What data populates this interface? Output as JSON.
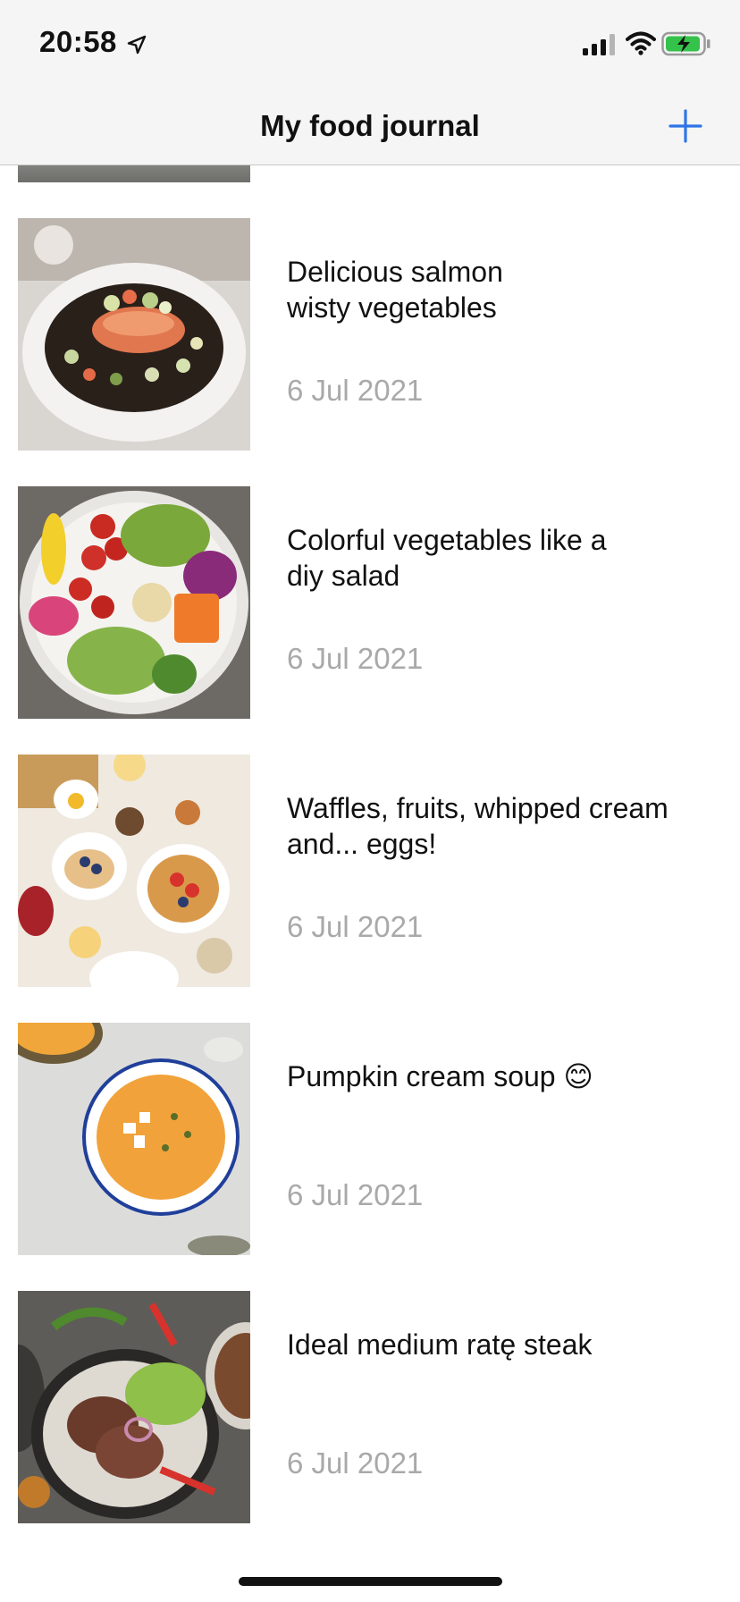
{
  "status_bar": {
    "time": "20:58"
  },
  "nav": {
    "title": "My food journal",
    "add_icon": "plus-icon",
    "accent_color": "#2f74e6"
  },
  "entries": [
    {
      "title": "Delicious salmon\nwisty vegetables",
      "date": "6 Jul 2021",
      "image": "salmon-plate"
    },
    {
      "title": "Colorful vegetables like a\ndiy salad",
      "date": "6 Jul 2021",
      "image": "salad-bowl"
    },
    {
      "title": "Waffles, fruits, whipped cream\nand... eggs!",
      "date": "6 Jul 2021",
      "image": "waffles-table"
    },
    {
      "title": "Pumpkin cream soup 😊",
      "date": "6 Jul 2021",
      "image": "pumpkin-soup"
    },
    {
      "title": "Ideal medium ratę steak",
      "date": "6 Jul 2021",
      "image": "steak-plate"
    }
  ]
}
